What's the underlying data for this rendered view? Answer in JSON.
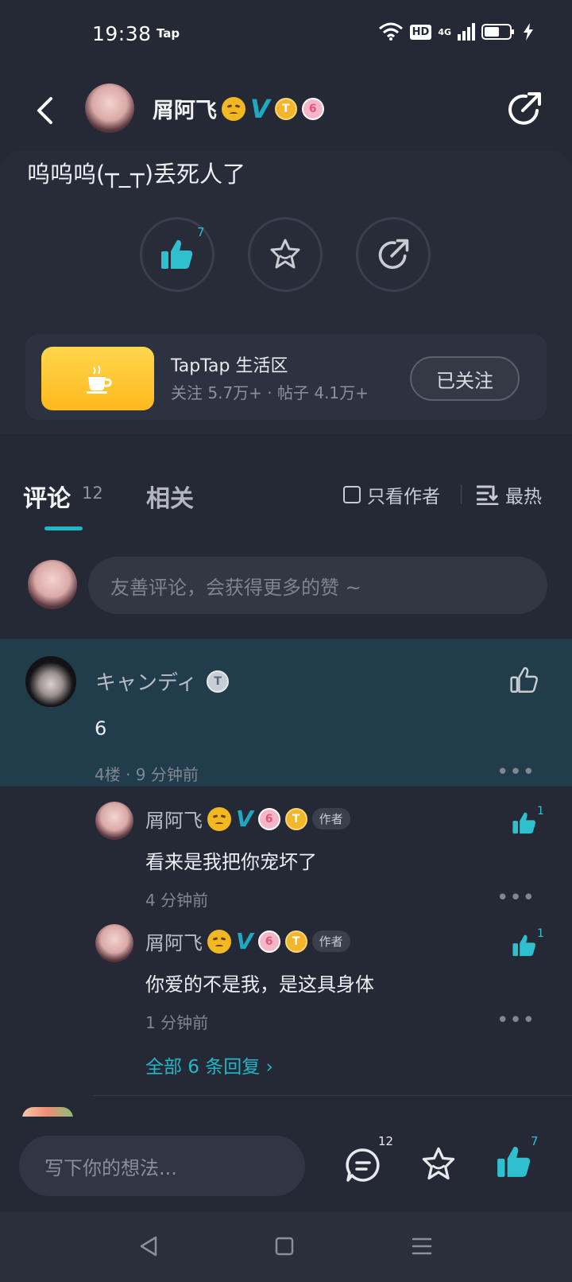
{
  "status_bar": {
    "time": "19:38",
    "carrier": "Tap",
    "hd": "HD",
    "network": "4G"
  },
  "header": {
    "author_name": "屑阿飞",
    "verified_mark": "V",
    "badge_t": "T",
    "badge_6": "6"
  },
  "post": {
    "text": "呜呜呜(┬_┬)丢死人了",
    "like_count": "7"
  },
  "forum": {
    "title": "TapTap 生活区",
    "stats": "关注 5.7万+ · 帖子 4.1万+",
    "follow_label": "已关注"
  },
  "tabs": {
    "comments_label": "评论",
    "comments_count": "12",
    "related_label": "相关",
    "author_only_label": "只看作者",
    "sort_label": "最热"
  },
  "comment_input": {
    "placeholder": "友善评论，会获得更多的赞 ~"
  },
  "comment": {
    "user_name": "キャンディ",
    "badge": "T",
    "text": "6",
    "meta": "4楼 · 9 分钟前",
    "more": "•••"
  },
  "replies": [
    {
      "user_name": "屑阿飞",
      "author_tag": "作者",
      "text": "看来是我把你宠坏了",
      "meta": "4 分钟前",
      "like_count": "1"
    },
    {
      "user_name": "屑阿飞",
      "author_tag": "作者",
      "text": "你爱的不是我，是这具身体",
      "meta": "1 分钟前",
      "like_count": "1"
    }
  ],
  "all_replies_label": "全部 6 条回复 ›",
  "bottom_bar": {
    "placeholder": "写下你的想法...",
    "comment_count": "12",
    "like_count": "7"
  },
  "colors": {
    "accent": "#1fb8c7",
    "background": "#252936",
    "highlight": "#213c4a"
  }
}
